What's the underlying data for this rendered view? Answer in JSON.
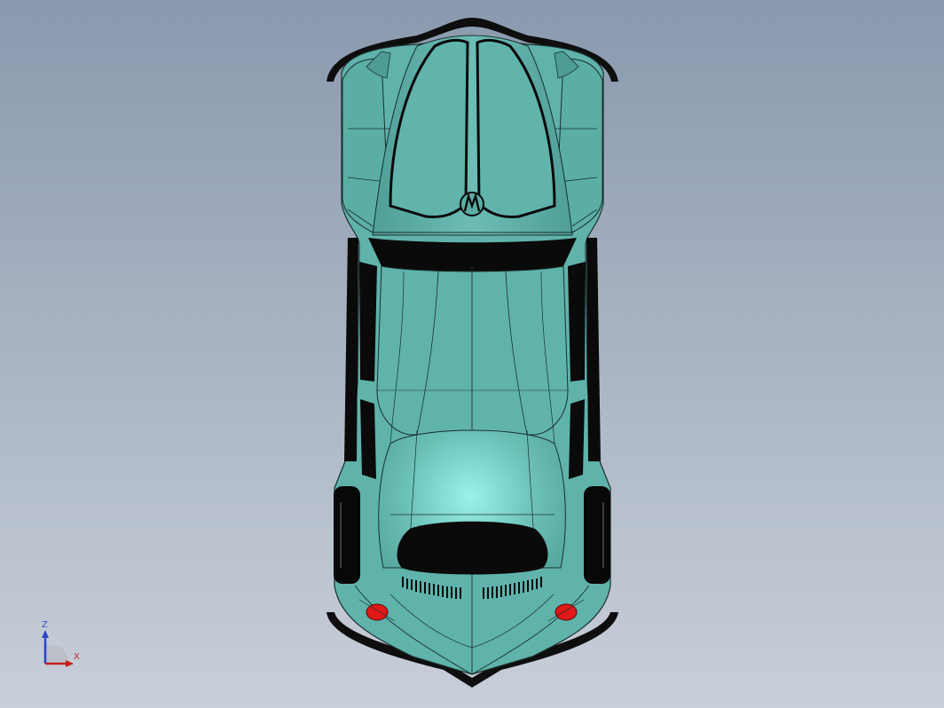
{
  "viewport": {
    "background_top": "#8a99ae",
    "background_bottom": "#c9cfd9"
  },
  "model": {
    "view": "top",
    "body_color": "#5fb3ab",
    "body_highlight": "#9aefe9",
    "outline_color": "#0a0a0a",
    "tail_light_color": "#e01818"
  },
  "triad": {
    "z_label": "Z",
    "x_label": "X",
    "z_color": "#2b49c4",
    "x_color": "#c41e1e"
  }
}
